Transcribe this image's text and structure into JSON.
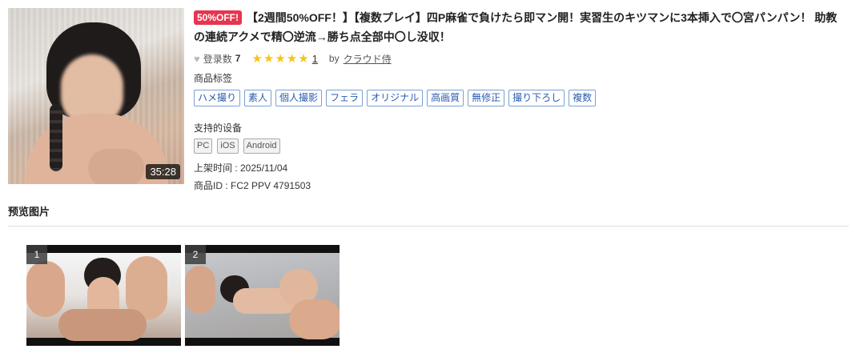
{
  "product": {
    "duration": "35:28",
    "sale_badge": "50%OFF!",
    "title": "【2週間50%OFF！】【複数プレイ】四P麻雀で負けたら即マン開！実習生のキツマンに3本挿入で〇宮パンパン！ 助教の連続アクメで精〇逆流→勝ち点全部中〇し没収！",
    "favorite_label": "登录数",
    "favorite_count": "7",
    "rating_stars": "★★★★★",
    "review_count": "1",
    "by_label": "by",
    "seller": "クラウド侍",
    "tags_label": "商品标签",
    "tags": [
      "ハメ撮り",
      "素人",
      "個人撮影",
      "フェラ",
      "オリジナル",
      "高画質",
      "無修正",
      "撮り下ろし",
      "複数"
    ],
    "devices_label": "支持的设备",
    "devices": [
      "PC",
      "iOS",
      "Android"
    ],
    "release_label": "上架时间 : 2025/11/04",
    "product_id_label": "商品ID : FC2 PPV 4791503"
  },
  "preview": {
    "heading": "预览图片",
    "images": [
      {
        "number": "1"
      },
      {
        "number": "2"
      }
    ]
  },
  "colors": {
    "sale_badge": "#e8344e",
    "tag_text": "#2a5db0",
    "star": "#f5c518"
  },
  "icons": {
    "favorite": "heart-icon",
    "rating": "star-icon"
  }
}
